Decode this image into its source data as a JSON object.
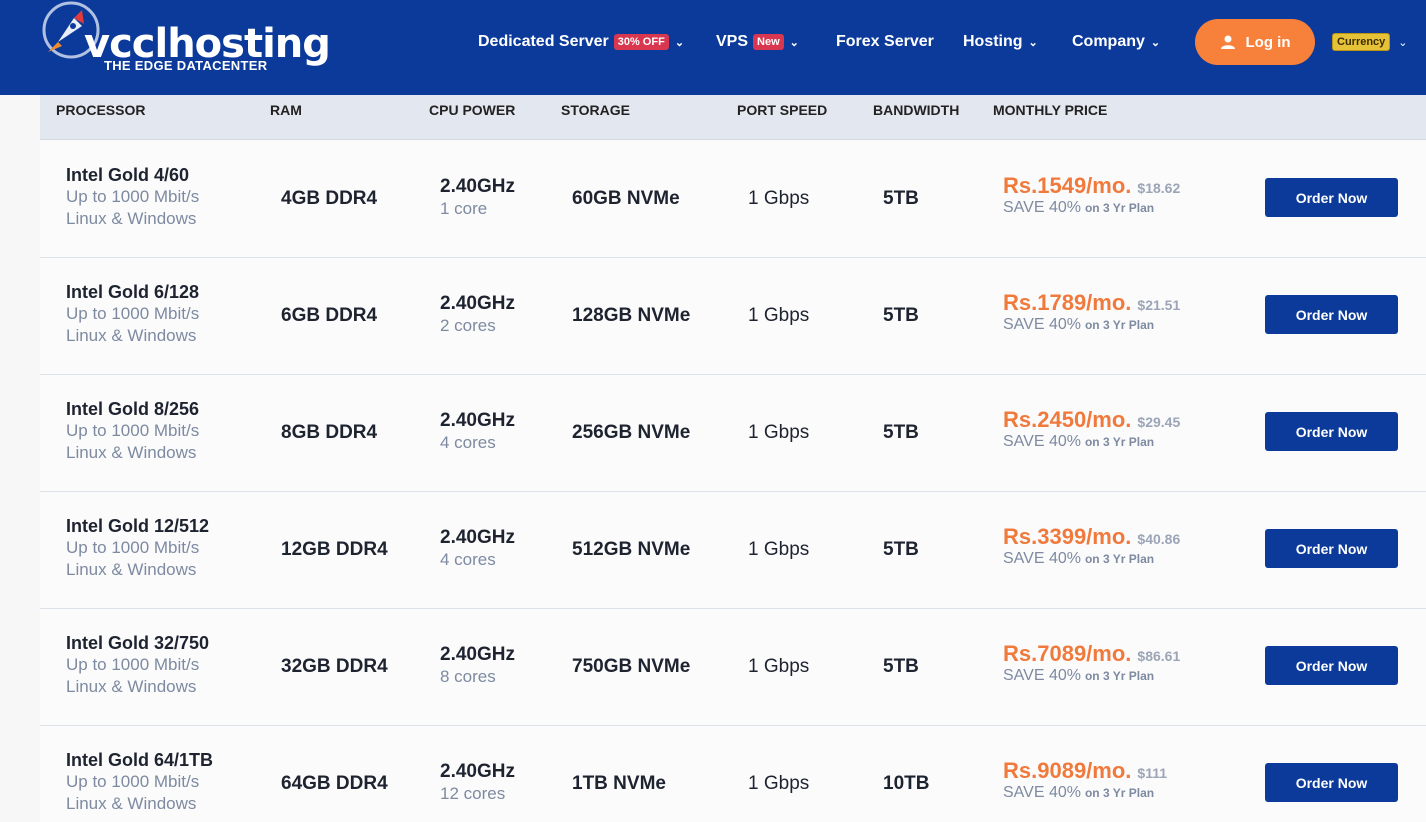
{
  "header": {
    "logo_text": "vcclhosting",
    "logo_tagline": "THE EDGE DATACENTER",
    "nav": [
      {
        "label": "Dedicated Server",
        "badge": "30% OFF"
      },
      {
        "label": "VPS",
        "badge": "New"
      },
      {
        "label": "Forex Server"
      },
      {
        "label": "Hosting"
      },
      {
        "label": "Company"
      }
    ],
    "login_label": "Log in",
    "currency_label": "Currency",
    "brand_color": "#0b3a9a",
    "accent_color": "#f7813b"
  },
  "table": {
    "columns": [
      "PROCESSOR",
      "RAM",
      "CPU POWER",
      "STORAGE",
      "PORT SPEED",
      "BANDWIDTH",
      "MONTHLY PRICE"
    ],
    "rows": [
      {
        "name": "Intel Gold 4/60",
        "port": "Up to 1000 Mbit/s",
        "os": "Linux & Windows",
        "ram": "4GB DDR4",
        "cpu": "2.40GHz",
        "cores": "1 core",
        "storage": "60GB NVMe",
        "speed": "1 Gbps",
        "bandwidth": "5TB",
        "price": "Rs.1549/mo.",
        "usd": "$18.62",
        "save": "SAVE 40%",
        "plan": "on 3 Yr Plan",
        "button": "Order Now"
      },
      {
        "name": "Intel Gold 6/128",
        "port": "Up to 1000 Mbit/s",
        "os": "Linux & Windows",
        "ram": "6GB DDR4",
        "cpu": "2.40GHz",
        "cores": "2 cores",
        "storage": "128GB NVMe",
        "speed": "1 Gbps",
        "bandwidth": "5TB",
        "price": "Rs.1789/mo.",
        "usd": "$21.51",
        "save": "SAVE 40%",
        "plan": "on 3 Yr Plan",
        "button": "Order Now"
      },
      {
        "name": "Intel Gold 8/256",
        "port": "Up to 1000 Mbit/s",
        "os": "Linux & Windows",
        "ram": "8GB DDR4",
        "cpu": "2.40GHz",
        "cores": "4 cores",
        "storage": "256GB NVMe",
        "speed": "1 Gbps",
        "bandwidth": "5TB",
        "price": "Rs.2450/mo.",
        "usd": "$29.45",
        "save": "SAVE 40%",
        "plan": "on 3 Yr Plan",
        "button": "Order Now"
      },
      {
        "name": "Intel Gold 12/512",
        "port": "Up to 1000 Mbit/s",
        "os": "Linux & Windows",
        "ram": "12GB DDR4",
        "cpu": "2.40GHz",
        "cores": "4 cores",
        "storage": "512GB NVMe",
        "speed": "1 Gbps",
        "bandwidth": "5TB",
        "price": "Rs.3399/mo.",
        "usd": "$40.86",
        "save": "SAVE 40%",
        "plan": "on 3 Yr Plan",
        "button": "Order Now"
      },
      {
        "name": "Intel Gold 32/750",
        "port": "Up to 1000 Mbit/s",
        "os": "Linux & Windows",
        "ram": "32GB DDR4",
        "cpu": "2.40GHz",
        "cores": "8 cores",
        "storage": "750GB NVMe",
        "speed": "1 Gbps",
        "bandwidth": "5TB",
        "price": "Rs.7089/mo.",
        "usd": "$86.61",
        "save": "SAVE 40%",
        "plan": "on 3 Yr Plan",
        "button": "Order Now"
      },
      {
        "name": "Intel Gold 64/1TB",
        "port": "Up to 1000 Mbit/s",
        "os": "Linux & Windows",
        "ram": "64GB DDR4",
        "cpu": "2.40GHz",
        "cores": "12 cores",
        "storage": "1TB NVMe",
        "speed": "1 Gbps",
        "bandwidth": "10TB",
        "price": "Rs.9089/mo.",
        "usd": "$111",
        "save": "SAVE 40%",
        "plan": "on 3 Yr Plan",
        "button": "Order Now"
      }
    ]
  }
}
